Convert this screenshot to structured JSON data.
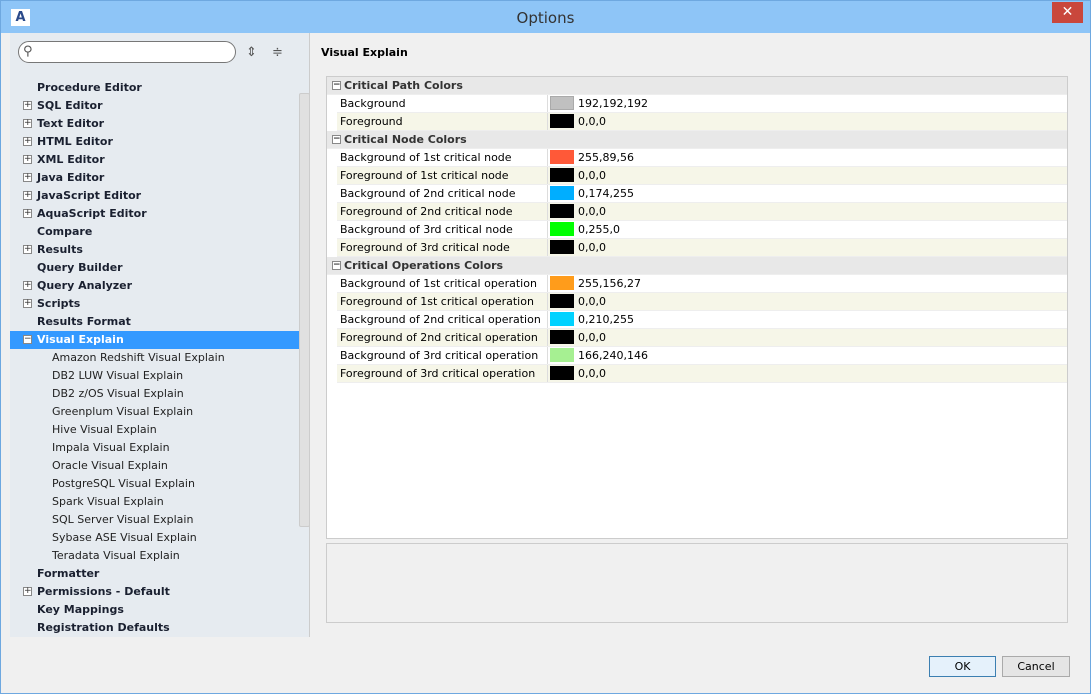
{
  "window": {
    "title": "Options",
    "logo": "A",
    "close": "✕"
  },
  "sidebar": {
    "search_placeholder": "",
    "items": [
      {
        "label": "Procedure Editor",
        "expander": ""
      },
      {
        "label": "SQL Editor",
        "expander": "+"
      },
      {
        "label": "Text Editor",
        "expander": "+"
      },
      {
        "label": "HTML Editor",
        "expander": "+"
      },
      {
        "label": "XML Editor",
        "expander": "+"
      },
      {
        "label": "Java Editor",
        "expander": "+"
      },
      {
        "label": "JavaScript Editor",
        "expander": "+"
      },
      {
        "label": "AquaScript Editor",
        "expander": "+"
      },
      {
        "label": "Compare",
        "expander": ""
      },
      {
        "label": "Results",
        "expander": "+"
      },
      {
        "label": "Query Builder",
        "expander": ""
      },
      {
        "label": "Query Analyzer",
        "expander": "+"
      },
      {
        "label": "Scripts",
        "expander": "+"
      },
      {
        "label": "Results Format",
        "expander": ""
      },
      {
        "label": "Visual Explain",
        "expander": "−",
        "selected": true,
        "children": [
          "Amazon Redshift Visual Explain",
          "DB2 LUW Visual Explain",
          "DB2 z/OS Visual Explain",
          "Greenplum Visual Explain",
          "Hive Visual Explain",
          "Impala Visual Explain",
          "Oracle Visual Explain",
          "PostgreSQL Visual Explain",
          "Spark Visual Explain",
          "SQL Server Visual Explain",
          "Sybase ASE Visual Explain",
          "Teradata Visual Explain"
        ]
      },
      {
        "label": "Formatter",
        "expander": ""
      },
      {
        "label": "Permissions - Default",
        "expander": "+"
      },
      {
        "label": "Key Mappings",
        "expander": ""
      },
      {
        "label": "Registration Defaults",
        "expander": ""
      }
    ]
  },
  "main": {
    "title": "Visual Explain",
    "categories": [
      {
        "label": "Critical Path Colors",
        "props": [
          {
            "name": "Background",
            "value": "192,192,192",
            "color": "#c0c0c0"
          },
          {
            "name": "Foreground",
            "value": "0,0,0",
            "color": "#000000"
          }
        ]
      },
      {
        "label": "Critical Node Colors",
        "props": [
          {
            "name": "Background of 1st critical node",
            "value": "255,89,56",
            "color": "#ff5938"
          },
          {
            "name": "Foreground of 1st critical node",
            "value": "0,0,0",
            "color": "#000000"
          },
          {
            "name": "Background of 2nd critical node",
            "value": "0,174,255",
            "color": "#00aeff"
          },
          {
            "name": "Foreground of 2nd critical node",
            "value": "0,0,0",
            "color": "#000000"
          },
          {
            "name": "Background of 3rd critical node",
            "value": "0,255,0",
            "color": "#00ff00"
          },
          {
            "name": "Foreground of 3rd critical node",
            "value": "0,0,0",
            "color": "#000000"
          }
        ]
      },
      {
        "label": "Critical Operations Colors",
        "props": [
          {
            "name": "Background of 1st critical operation",
            "value": "255,156,27",
            "color": "#ff9c1b"
          },
          {
            "name": "Foreground of 1st critical operation",
            "value": "0,0,0",
            "color": "#000000"
          },
          {
            "name": "Background of 2nd critical operation",
            "value": "0,210,255",
            "color": "#00d2ff"
          },
          {
            "name": "Foreground of 2nd critical operation",
            "value": "0,0,0",
            "color": "#000000"
          },
          {
            "name": "Background of 3rd critical operation",
            "value": "166,240,146",
            "color": "#a6f092"
          },
          {
            "name": "Foreground of 3rd critical operation",
            "value": "0,0,0",
            "color": "#000000"
          }
        ]
      }
    ]
  },
  "buttons": {
    "ok": "OK",
    "cancel": "Cancel"
  }
}
